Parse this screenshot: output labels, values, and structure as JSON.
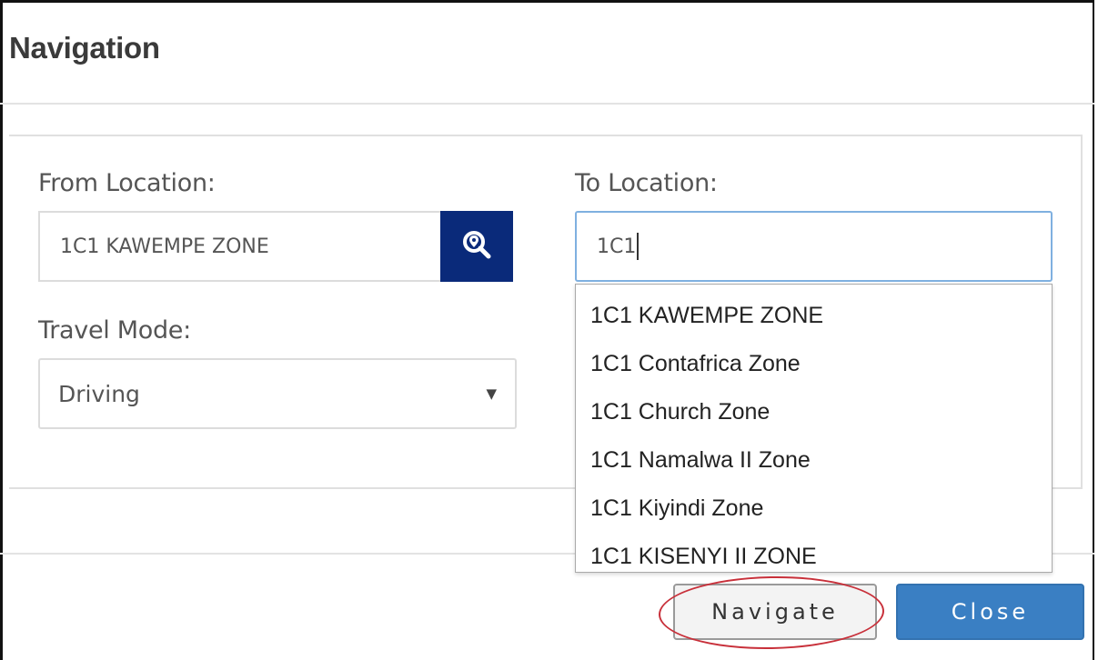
{
  "modal": {
    "title": "Navigation"
  },
  "form": {
    "from_label": "From Location:",
    "from_value": "1C1 KAWEMPE ZONE",
    "to_label": "To Location:",
    "to_value": "1C1",
    "travel_mode_label": "Travel Mode:",
    "travel_mode_value": "Driving"
  },
  "autocomplete": {
    "items": [
      "1C1 KAWEMPE ZONE",
      "1C1 Contafrica Zone",
      "1C1 Church Zone",
      "1C1 Namalwa II Zone",
      "1C1 Kiyindi Zone",
      "1C1 KISENYI II ZONE"
    ]
  },
  "footer": {
    "navigate_label": "Navigate",
    "close_label": "Close"
  },
  "colors": {
    "search_button": "#0a2a7a",
    "close_button": "#3a7fc3",
    "highlight_ellipse": "#c8303a"
  },
  "icons": {
    "search": "search-location-icon",
    "dropdown": "caret-down-icon"
  }
}
